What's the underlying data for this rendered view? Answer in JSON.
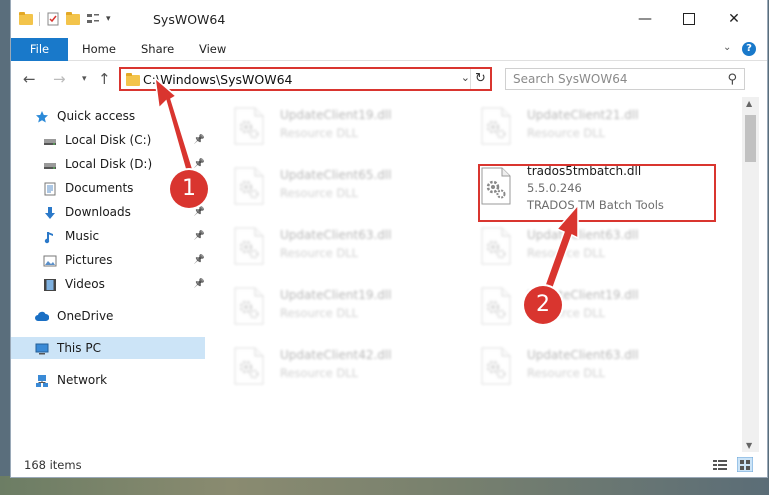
{
  "window": {
    "title": "SysWOW64"
  },
  "ribbon": {
    "tabs": [
      "File",
      "Home",
      "Share",
      "View"
    ]
  },
  "address": {
    "path": "C:\\Windows\\SysWOW64",
    "search_placeholder": "Search SysWOW64"
  },
  "sidebar": {
    "items": [
      {
        "label": "Quick access",
        "icon": "star-icon",
        "pinned": false
      },
      {
        "label": "Local Disk (C:)",
        "icon": "drive-icon",
        "pinned": true
      },
      {
        "label": "Local Disk (D:)",
        "icon": "drive-icon",
        "pinned": true
      },
      {
        "label": "Documents",
        "icon": "documents-icon",
        "pinned": true
      },
      {
        "label": "Downloads",
        "icon": "download-icon",
        "pinned": true
      },
      {
        "label": "Music",
        "icon": "music-icon",
        "pinned": true
      },
      {
        "label": "Pictures",
        "icon": "pictures-icon",
        "pinned": true
      },
      {
        "label": "Videos",
        "icon": "videos-icon",
        "pinned": true
      },
      {
        "label": "OneDrive",
        "icon": "cloud-icon",
        "pinned": false
      },
      {
        "label": "This PC",
        "icon": "pc-icon",
        "pinned": false
      },
      {
        "label": "Network",
        "icon": "network-icon",
        "pinned": false
      }
    ]
  },
  "files": [
    {
      "name": "UpdateClient19.dll",
      "desc": "Resource DLL"
    },
    {
      "name": "UpdateClient21.dll",
      "desc": "Resource DLL"
    },
    {
      "name": "UpdateClient65.dll",
      "desc": "Resource DLL"
    },
    {
      "name": "trados5tmbatch.dll",
      "version": "5.5.0.246",
      "desc": "TRADOS TM Batch Tools"
    },
    {
      "name": "UpdateClient63.dll",
      "desc": "Resource DLL"
    },
    {
      "name": "UpdateClient63.dll",
      "desc": "Resource DLL"
    },
    {
      "name": "UpdateClient19.dll",
      "desc": "Resource DLL"
    },
    {
      "name": "UpdateClient19.dll",
      "desc": "Resource DLL"
    },
    {
      "name": "UpdateClient42.dll",
      "desc": "Resource DLL"
    },
    {
      "name": "UpdateClient63.dll",
      "desc": "Resource DLL"
    }
  ],
  "status": {
    "item_count": "168 items"
  },
  "annotations": {
    "step1": "1",
    "step2": "2"
  },
  "colors": {
    "accent": "#1979ca",
    "highlight": "#d9352f",
    "selected": "#cce4f7"
  }
}
